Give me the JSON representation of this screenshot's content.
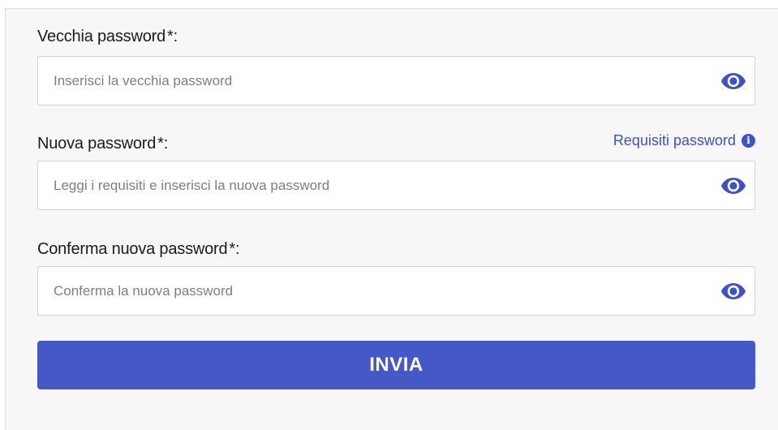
{
  "form": {
    "old_password": {
      "label": "Vecchia password",
      "required_mark": "*:",
      "placeholder": "Inserisci la vecchia password",
      "value": ""
    },
    "new_password": {
      "label": "Nuova password",
      "required_mark": "*:",
      "placeholder": "Leggi i requisiti e inserisci la nuova password",
      "value": "",
      "requirements_link": "Requisiti password"
    },
    "confirm_password": {
      "label": "Conferma nuova password",
      "required_mark": "*:",
      "placeholder": "Conferma la nuova password",
      "value": ""
    },
    "submit_label": "INVIA"
  },
  "icons": {
    "toggle": "eye-icon",
    "info": "info-icon"
  },
  "colors": {
    "accent": "#4657c7",
    "link": "#3f51c8",
    "panel_bg": "#f7f7f7"
  }
}
